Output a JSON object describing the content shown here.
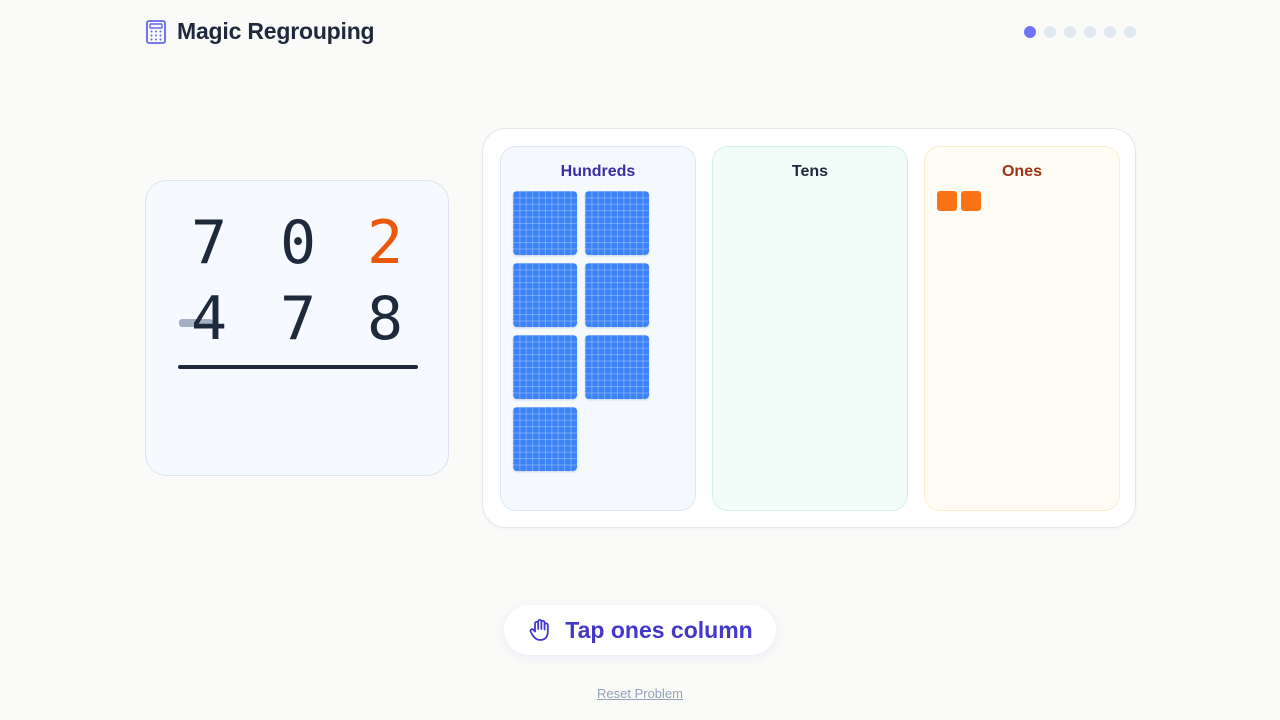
{
  "header": {
    "title": "Magic Regrouping",
    "icon": "calculator-icon"
  },
  "progress": {
    "total_steps": 6,
    "current_step": 1,
    "active_color": "#6366f1",
    "inactive_color": "#e2e8f0"
  },
  "problem": {
    "top_digits": [
      "7",
      "0",
      "2"
    ],
    "bottom_digits": [
      "4",
      "7",
      "8"
    ],
    "operator": "minus",
    "highlight_digit_color": "#ea580c"
  },
  "board": {
    "columns": [
      {
        "key": "hundreds",
        "label": "Hundreds",
        "block_count": 7,
        "block_color": "#3b82f6"
      },
      {
        "key": "tens",
        "label": "Tens",
        "block_count": 0,
        "block_color": "#10b981"
      },
      {
        "key": "ones",
        "label": "Ones",
        "block_count": 2,
        "block_color": "#f97316"
      }
    ]
  },
  "hint": {
    "icon": "hand-tap-icon",
    "text": "Tap ones column"
  },
  "reset": {
    "label": "Reset Problem"
  }
}
